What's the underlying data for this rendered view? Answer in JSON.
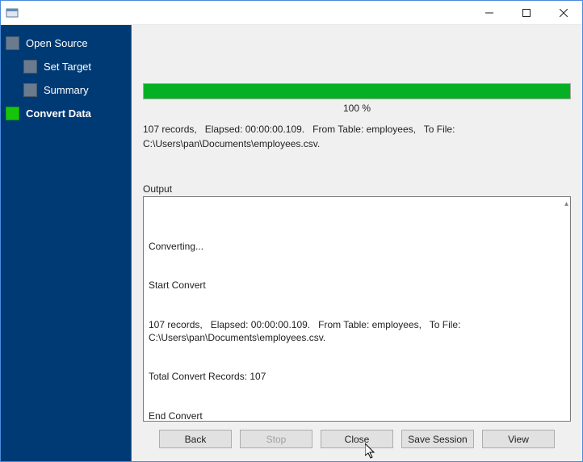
{
  "window": {
    "title": ""
  },
  "sidebar": {
    "items": [
      {
        "label": "Open Source",
        "indent": 0,
        "active": false
      },
      {
        "label": "Set Target",
        "indent": 1,
        "active": false
      },
      {
        "label": "Summary",
        "indent": 1,
        "active": false
      },
      {
        "label": "Convert Data",
        "indent": 0,
        "active": true
      }
    ]
  },
  "progress": {
    "percent_label": "100 %",
    "fill_percent": 100
  },
  "summary": "107 records,   Elapsed: 00:00:00.109.   From Table: employees,   To File: C:\\Users\\pan\\Documents\\employees.csv.",
  "output": {
    "label": "Output",
    "lines": [
      "Converting...",
      "Start Convert",
      "107 records,   Elapsed: 00:00:00.109.   From Table: employees,   To File: C:\\Users\\pan\\Documents\\employees.csv.",
      "Total Convert Records: 107",
      "End Convert"
    ]
  },
  "buttons": {
    "back": "Back",
    "stop": "Stop",
    "close": "Close",
    "save_session": "Save Session",
    "view": "View"
  }
}
